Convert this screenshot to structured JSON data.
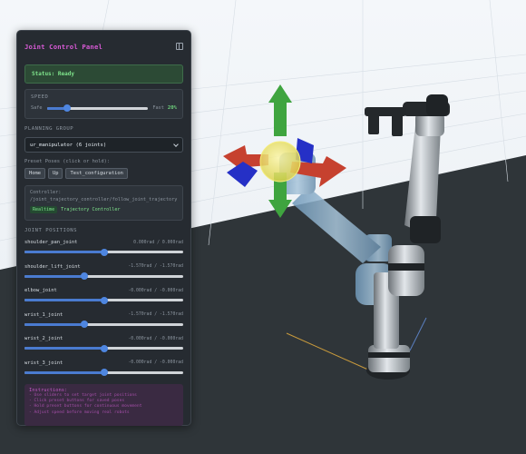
{
  "panel": {
    "title": "Joint Control Panel",
    "collapse_icon": "panel-collapse-icon",
    "status": "Status: Ready",
    "speed": {
      "label": "SPEED",
      "min_label": "Safe",
      "max_label": "Fast",
      "value": "20%",
      "fraction": 0.2
    },
    "planning_group": {
      "label": "PLANNING GROUP",
      "selected": "ur_manipulator (6 joints)"
    },
    "presets": {
      "hint": "Preset Poses (click or hold):",
      "buttons": [
        "Home",
        "Up",
        "Test_configuration"
      ]
    },
    "controller": {
      "label": "Controller:",
      "path": "/joint_trajectory_controller/follow_joint_trajectory",
      "badge": "Realtime",
      "type": "Trajectory Controller"
    },
    "joints": {
      "label": "JOINT POSITIONS",
      "items": [
        {
          "name": "shoulder_pan_joint",
          "value": "0.000rad / 0.000rad",
          "fraction": 0.5
        },
        {
          "name": "shoulder_lift_joint",
          "value": "-1.570rad / -1.570rad",
          "fraction": 0.375
        },
        {
          "name": "elbow_joint",
          "value": "-0.000rad / -0.000rad",
          "fraction": 0.5
        },
        {
          "name": "wrist_1_joint",
          "value": "-1.570rad / -1.570rad",
          "fraction": 0.375
        },
        {
          "name": "wrist_2_joint",
          "value": "-0.000rad / -0.000rad",
          "fraction": 0.5
        },
        {
          "name": "wrist_3_joint",
          "value": "-0.000rad / -0.000rad",
          "fraction": 0.5
        }
      ]
    },
    "instructions": {
      "title": "Instructions:",
      "lines": [
        "- Use sliders to set target joint positions",
        "- Click preset buttons for saved poses",
        "- Hold preset buttons for continuous movement",
        "- Adjust speed before moving real robots"
      ]
    }
  },
  "colors": {
    "panel_bg": "#262b31",
    "accent_magenta": "#d85ad6",
    "status_green": "#7ee38b",
    "slider_blue": "#4e86e0"
  }
}
